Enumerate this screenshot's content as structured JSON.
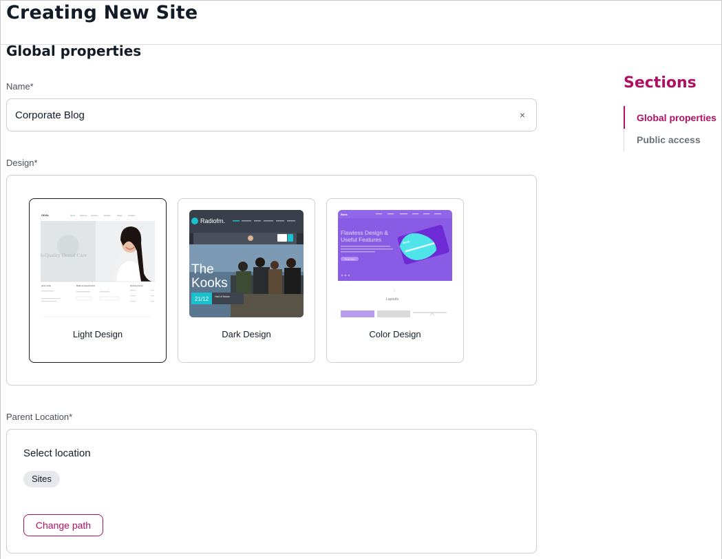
{
  "page": {
    "title": "Creating New Site"
  },
  "global": {
    "title": "Global properties",
    "name_label": "Name*",
    "name_value": "Corporate Blog",
    "clear_glyph": "×",
    "design_label": "Design*"
  },
  "designs": [
    {
      "label": "Light Design",
      "selected": true,
      "thumb": {
        "logo": "ODAL",
        "nav": [
          "Home",
          "About us",
          "Services",
          "Portfolio",
          "Pages",
          "Contacts"
        ],
        "headline": "h-Quality Dental Care",
        "columns": [
          "gency Help",
          "Make an Appointment",
          "Opening Hours"
        ]
      }
    },
    {
      "label": "Dark Design",
      "selected": false,
      "thumb": {
        "logo": "Radiofm.",
        "headline_line1": "The",
        "headline_line2": "Kooks",
        "date": "21/12",
        "venue": "Hall of Music"
      }
    },
    {
      "label": "Color Design",
      "selected": false,
      "thumb": {
        "logo": "Bank",
        "headline_line1": "Flawless Design &",
        "headline_line2": "Useful Features",
        "button": "Read More",
        "card_brand": "Bank",
        "layouts": "Layouts"
      }
    }
  ],
  "parent_location": {
    "label": "Parent Location*",
    "select_text": "Select location",
    "chip": "Sites",
    "change_button": "Change path"
  },
  "toc": {
    "title": "Sections",
    "items": [
      {
        "label": "Global properties",
        "active": true
      },
      {
        "label": "Public access",
        "active": false
      }
    ]
  },
  "colors": {
    "accent": "#ae1164",
    "text": "#131c26",
    "border": "#c9ccd1"
  },
  "icons": {
    "clear": "close-icon"
  }
}
